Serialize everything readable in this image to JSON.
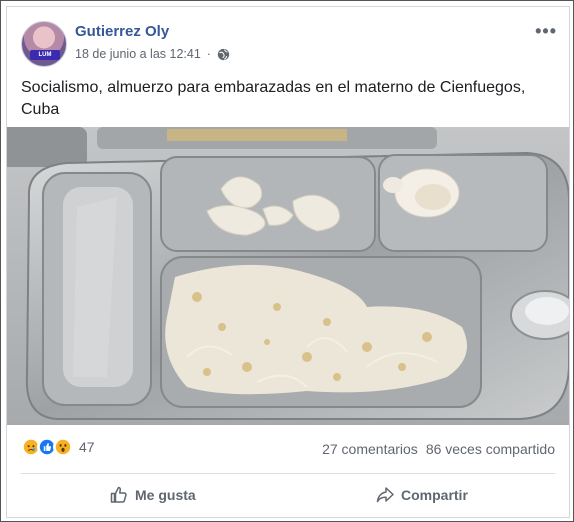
{
  "post": {
    "author": "Gutierrez Oly",
    "timestamp": "18 de junio a las 12:41",
    "text": "Socialismo, almuerzo para embarazadas en el materno de Cienfuegos, Cuba",
    "avatar_badge": "LUM",
    "more_icon": "more-horizontal-icon",
    "privacy_icon": "globe-icon"
  },
  "engagement": {
    "reactions": [
      "sad",
      "like",
      "wow"
    ],
    "reaction_count": "47",
    "comments": "27 comentarios",
    "shares": "86 veces compartido"
  },
  "actions": {
    "like_label": "Me gusta",
    "share_label": "Compartir"
  },
  "colors": {
    "author_link": "#365899",
    "secondary_text": "#606770",
    "like_blue": "#1877f2",
    "reaction_yellow": "#f7b125"
  }
}
